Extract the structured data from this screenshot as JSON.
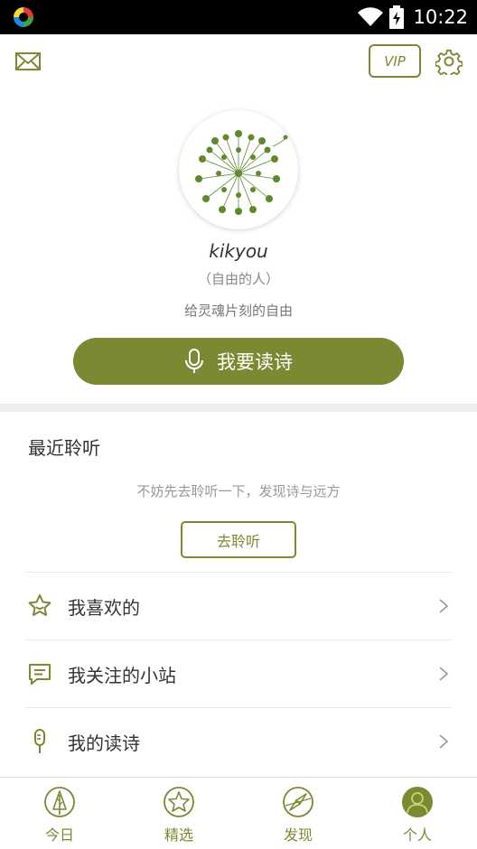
{
  "status_bar": {
    "time": "10:22"
  },
  "header": {
    "vip_label": "VIP"
  },
  "profile": {
    "username": "kikyou",
    "tagline": "（自由的人）",
    "bio": "给灵魂片刻的自由"
  },
  "read_button": {
    "label": "我要读诗"
  },
  "recent": {
    "title": "最近聆听",
    "empty_hint": "不妨先去聆听一下，发现诗与远方",
    "listen_label": "去聆听"
  },
  "menu": [
    {
      "label": "我喜欢的",
      "icon": "star-icon"
    },
    {
      "label": "我关注的小站",
      "icon": "chat-bubble-icon"
    },
    {
      "label": "我的读诗",
      "icon": "microphone-icon"
    }
  ],
  "bottom_nav": [
    {
      "label": "今日",
      "icon": "tree-icon",
      "active": false
    },
    {
      "label": "精选",
      "icon": "star-icon",
      "active": false
    },
    {
      "label": "发现",
      "icon": "compass-icon",
      "active": false
    },
    {
      "label": "个人",
      "icon": "person-icon",
      "active": true
    }
  ],
  "colors": {
    "accent": "#7a8a33",
    "divider": "#eeeeee",
    "statusbar": "#000000"
  }
}
